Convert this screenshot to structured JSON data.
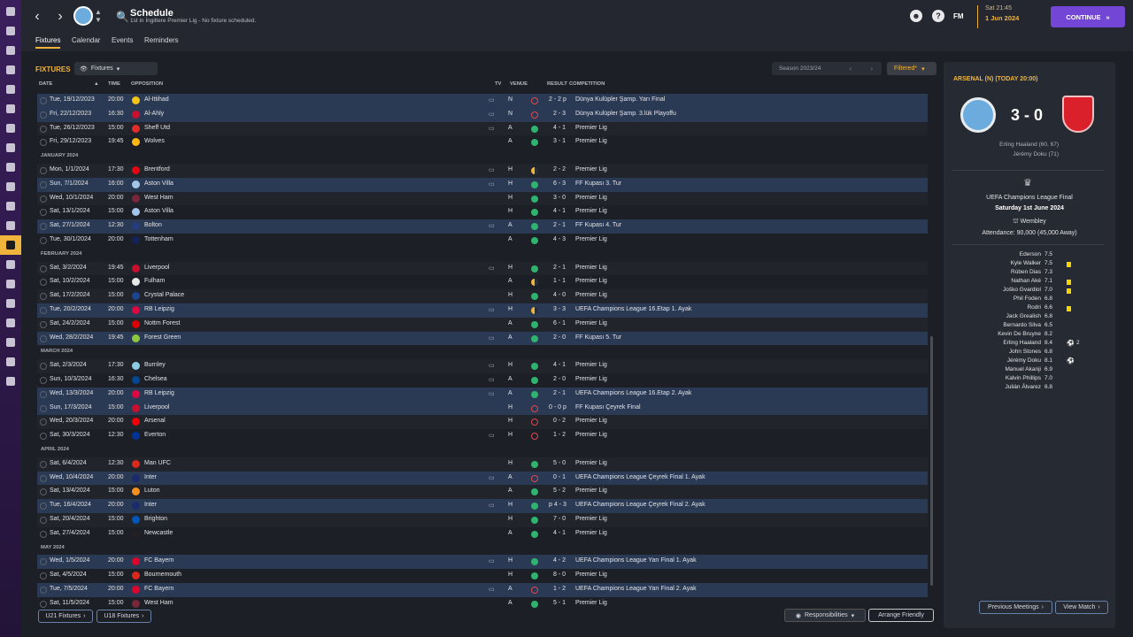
{
  "header": {
    "title": "Schedule",
    "subtitle": "1st in İngiltere Premier Lig - No fixture scheduled.",
    "fm_label": "FM",
    "date_time": "Sat 21:45",
    "date": "1 Jun 2024",
    "continue_label": "CONTINUE"
  },
  "tabs": [
    "Fixtures",
    "Calendar",
    "Events",
    "Reminders"
  ],
  "fixtures": {
    "heading": "FIXTURES",
    "dropdown": "Fixtures",
    "season": "Season 2023/24",
    "filter": "Filtered*",
    "columns": {
      "date": "DATE",
      "time": "TIME",
      "opposition": "OPPOSITION",
      "tv": "TV",
      "venue": "VENUE",
      "result": "RESULT",
      "competition": "COMPETITION"
    }
  },
  "rows": [
    {
      "date": "Tue, 19/12/2023",
      "time": "20:00",
      "opp": "Al-Ittihad",
      "badge": "#f2c418",
      "tv": true,
      "venue": "N",
      "res": "L",
      "score": "2 - 2 p",
      "comp": "Dünya Kulüpler Şamp. Yarı Final",
      "hl": true
    },
    {
      "date": "Fri, 22/12/2023",
      "time": "16:30",
      "opp": "Al-Ahly",
      "badge": "#c8102e",
      "tv": true,
      "venue": "N",
      "res": "L",
      "score": "2 - 3",
      "comp": "Dünya Kulüpler Şamp. 3.lük Playoffu",
      "hl": true
    },
    {
      "date": "Tue, 26/12/2023",
      "time": "15:00",
      "opp": "Sheff Utd",
      "badge": "#e22b2b",
      "tv": true,
      "venue": "A",
      "res": "W",
      "score": "4 - 1",
      "comp": "Premier Lig"
    },
    {
      "date": "Fri, 29/12/2023",
      "time": "19:45",
      "opp": "Wolves",
      "badge": "#fdb913",
      "tv": false,
      "venue": "A",
      "res": "W",
      "score": "3 - 1",
      "comp": "Premier Lig"
    },
    {
      "month": "JANUARY 2024"
    },
    {
      "date": "Mon, 1/1/2024",
      "time": "17:30",
      "opp": "Brentford",
      "badge": "#e30613",
      "tv": true,
      "venue": "H",
      "res": "D",
      "score": "2 - 2",
      "comp": "Premier Lig"
    },
    {
      "date": "Sun, 7/1/2024",
      "time": "16:00",
      "opp": "Aston Villa",
      "badge": "#a3c5e9",
      "tv": true,
      "venue": "H",
      "res": "W",
      "score": "6 - 3",
      "comp": "FF Kupası 3. Tur",
      "hl": true
    },
    {
      "date": "Wed, 10/1/2024",
      "time": "20:00",
      "opp": "West Ham",
      "badge": "#7a263a",
      "tv": false,
      "venue": "H",
      "res": "W",
      "score": "3 - 0",
      "comp": "Premier Lig"
    },
    {
      "date": "Sat, 13/1/2024",
      "time": "15:00",
      "opp": "Aston Villa",
      "badge": "#a3c5e9",
      "tv": false,
      "venue": "H",
      "res": "W",
      "score": "4 - 1",
      "comp": "Premier Lig"
    },
    {
      "date": "Sat, 27/1/2024",
      "time": "12:30",
      "opp": "Bolton",
      "badge": "#263c7e",
      "tv": true,
      "venue": "A",
      "res": "W",
      "score": "2 - 1",
      "comp": "FF Kupası 4. Tur",
      "hl": true
    },
    {
      "date": "Tue, 30/1/2024",
      "time": "20:00",
      "opp": "Tottenham",
      "badge": "#132257",
      "tv": false,
      "venue": "A",
      "res": "W",
      "score": "4 - 3",
      "comp": "Premier Lig"
    },
    {
      "month": "FEBRUARY 2024"
    },
    {
      "date": "Sat, 3/2/2024",
      "time": "19:45",
      "opp": "Liverpool",
      "badge": "#c8102e",
      "tv": true,
      "venue": "H",
      "res": "W",
      "score": "2 - 1",
      "comp": "Premier Lig"
    },
    {
      "date": "Sat, 10/2/2024",
      "time": "15:00",
      "opp": "Fulham",
      "badge": "#e8e8e8",
      "tv": false,
      "venue": "A",
      "res": "D",
      "score": "1 - 1",
      "comp": "Premier Lig"
    },
    {
      "date": "Sat, 17/2/2024",
      "time": "15:00",
      "opp": "Crystal Palace",
      "badge": "#1b458f",
      "tv": false,
      "venue": "H",
      "res": "W",
      "score": "4 - 0",
      "comp": "Premier Lig"
    },
    {
      "date": "Tue, 20/2/2024",
      "time": "20:00",
      "opp": "RB Leipzig",
      "badge": "#dd0741",
      "tv": true,
      "venue": "H",
      "res": "D",
      "score": "3 - 3",
      "comp": "UEFA Champions League 16.Etap 1. Ayak",
      "hl": true
    },
    {
      "date": "Sat, 24/2/2024",
      "time": "15:00",
      "opp": "Nottm Forest",
      "badge": "#dd0000",
      "tv": false,
      "venue": "A",
      "res": "W",
      "score": "6 - 1",
      "comp": "Premier Lig"
    },
    {
      "date": "Wed, 28/2/2024",
      "time": "19:45",
      "opp": "Forest Green",
      "badge": "#8cc63f",
      "tv": true,
      "venue": "A",
      "res": "W",
      "score": "2 - 0",
      "comp": "FF Kupası 5. Tur",
      "hl": true
    },
    {
      "month": "MARCH 2024"
    },
    {
      "date": "Sat, 2/3/2024",
      "time": "17:30",
      "opp": "Burnley",
      "badge": "#8ccce5",
      "tv": true,
      "venue": "H",
      "res": "W",
      "score": "4 - 1",
      "comp": "Premier Lig"
    },
    {
      "date": "Sun, 10/3/2024",
      "time": "16:30",
      "opp": "Chelsea",
      "badge": "#034694",
      "tv": true,
      "venue": "A",
      "res": "W",
      "score": "2 - 0",
      "comp": "Premier Lig"
    },
    {
      "date": "Wed, 13/3/2024",
      "time": "20:00",
      "opp": "RB Leipzig",
      "badge": "#dd0741",
      "tv": true,
      "venue": "A",
      "res": "W",
      "score": "2 - 1",
      "comp": "UEFA Champions League 16.Etap 2. Ayak",
      "hl": true
    },
    {
      "date": "Sun, 17/3/2024",
      "time": "15:00",
      "opp": "Liverpool",
      "badge": "#c8102e",
      "tv": false,
      "venue": "H",
      "res": "L",
      "score": "0 - 0 p",
      "comp": "FF Kupası Çeyrek Final",
      "hl": true
    },
    {
      "date": "Wed, 20/3/2024",
      "time": "20:00",
      "opp": "Arsenal",
      "badge": "#ef0107",
      "tv": false,
      "venue": "H",
      "res": "L",
      "score": "0 - 2",
      "comp": "Premier Lig"
    },
    {
      "date": "Sat, 30/3/2024",
      "time": "12:30",
      "opp": "Everton",
      "badge": "#003399",
      "tv": true,
      "venue": "H",
      "res": "L",
      "score": "1 - 2",
      "comp": "Premier Lig"
    },
    {
      "month": "APRIL 2024"
    },
    {
      "date": "Sat, 6/4/2024",
      "time": "12:30",
      "opp": "Man UFC",
      "badge": "#da291c",
      "tv": false,
      "venue": "H",
      "res": "W",
      "score": "5 - 0",
      "comp": "Premier Lig"
    },
    {
      "date": "Wed, 10/4/2024",
      "time": "20:00",
      "opp": "Inter",
      "badge": "#1a2b6d",
      "tv": true,
      "venue": "A",
      "res": "L",
      "score": "0 - 1",
      "comp": "UEFA Champions League Çeyrek Final 1. Ayak",
      "hl": true
    },
    {
      "date": "Sat, 13/4/2024",
      "time": "15:00",
      "opp": "Luton",
      "badge": "#f78f1e",
      "tv": false,
      "venue": "A",
      "res": "W",
      "score": "5 - 2",
      "comp": "Premier Lig"
    },
    {
      "date": "Tue, 16/4/2024",
      "time": "20:00",
      "opp": "Inter",
      "badge": "#1a2b6d",
      "tv": true,
      "venue": "H",
      "res": "W",
      "score": "p 4 - 3",
      "comp": "UEFA Champions League Çeyrek Final 2. Ayak",
      "hl": true
    },
    {
      "date": "Sat, 20/4/2024",
      "time": "15:00",
      "opp": "Brighton",
      "badge": "#0057b8",
      "tv": false,
      "venue": "H",
      "res": "W",
      "score": "7 - 0",
      "comp": "Premier Lig"
    },
    {
      "date": "Sat, 27/4/2024",
      "time": "15:00",
      "opp": "Newcastle",
      "badge": "#241f20",
      "tv": false,
      "venue": "A",
      "res": "W",
      "score": "4 - 1",
      "comp": "Premier Lig"
    },
    {
      "month": "MAY 2024"
    },
    {
      "date": "Wed, 1/5/2024",
      "time": "20:00",
      "opp": "FC Bayern",
      "badge": "#dc052d",
      "tv": true,
      "venue": "H",
      "res": "W",
      "score": "4 - 2",
      "comp": "UEFA Champions League Yarı Final 1. Ayak",
      "hl": true
    },
    {
      "date": "Sat, 4/5/2024",
      "time": "15:00",
      "opp": "Bournemouth",
      "badge": "#da291c",
      "tv": false,
      "venue": "H",
      "res": "W",
      "score": "8 - 0",
      "comp": "Premier Lig"
    },
    {
      "date": "Tue, 7/5/2024",
      "time": "20:00",
      "opp": "FC Bayern",
      "badge": "#dc052d",
      "tv": true,
      "venue": "A",
      "res": "L",
      "score": "1 - 2",
      "comp": "UEFA Champions League Yarı Final 2. Ayak",
      "hl": true
    },
    {
      "date": "Sat, 11/5/2024",
      "time": "15:00",
      "opp": "West Ham",
      "badge": "#7a263a",
      "tv": false,
      "venue": "A",
      "res": "W",
      "score": "5 - 1",
      "comp": "Premier Lig"
    }
  ],
  "bottom": {
    "u21": "U21 Fixtures",
    "u18": "U18 Fixtures",
    "responsibilities": "Responsibilities",
    "arrange": "Arrange Friendly"
  },
  "match": {
    "title": "ARSENAL (N) (TODAY 20:00)",
    "score": "3 - 0",
    "scorers": [
      "Erling Haaland (60, 67)",
      "Jérémy Doku (71)"
    ],
    "competition": "UEFA Champions League Final",
    "date": "Saturday 1st June 2024",
    "stadium": "Wembley",
    "attendance": "Attendance: 90,000 (45,000 Away)",
    "lineup": [
      {
        "name": "Ederson",
        "rating": "7.5"
      },
      {
        "name": "Kyle Walker",
        "rating": "7.5",
        "yellow": true
      },
      {
        "name": "Rúben Dias",
        "rating": "7.3"
      },
      {
        "name": "Nathan Aké",
        "rating": "7.1",
        "yellow": true
      },
      {
        "name": "Joško Gvardiol",
        "rating": "7.0",
        "yellow": true
      },
      {
        "name": "Phil Foden",
        "rating": "6.8"
      },
      {
        "name": "Rodri",
        "rating": "6.6",
        "yellow": true
      },
      {
        "name": "Jack Grealish",
        "rating": "6.8"
      },
      {
        "name": "Bernardo Silva",
        "rating": "6.5"
      },
      {
        "name": "Kevin De Bruyne",
        "rating": "8.2"
      },
      {
        "name": "Erling Haaland",
        "rating": "8.4",
        "goals": "2"
      },
      {
        "name": "John Stones",
        "rating": "6.8"
      },
      {
        "name": "Jérémy Doku",
        "rating": "8.1",
        "goals": ""
      },
      {
        "name": "Manuel Akanji",
        "rating": "6.9"
      },
      {
        "name": "Kalvin Phillips",
        "rating": "7.0"
      },
      {
        "name": "Julián Álvarez",
        "rating": "6.8"
      }
    ],
    "prev_label": "Previous Meetings",
    "view_label": "View Match"
  }
}
